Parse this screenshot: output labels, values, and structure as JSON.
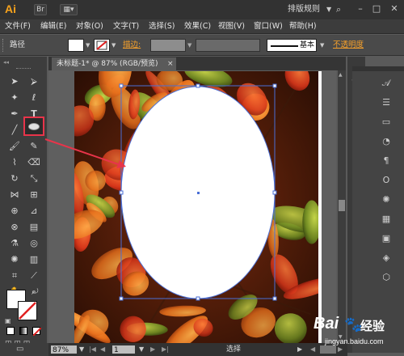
{
  "app": {
    "logo": "Ai"
  },
  "titlebar": {
    "preset_label": "排版规则",
    "buttons": [
      "Br",
      "St"
    ]
  },
  "menu": [
    "文件(F)",
    "编辑(E)",
    "对象(O)",
    "文字(T)",
    "选择(S)",
    "效果(C)",
    "视图(V)",
    "窗口(W)",
    "帮助(H)"
  ],
  "controlbar": {
    "path_label": "路径",
    "stroke_label": "描边:",
    "stroke_style": "基本",
    "opacity_label": "不透明度",
    "fill_color": "#ffffff",
    "stroke_color": "#e02020"
  },
  "document": {
    "tab_title": "未标题-1* @ 87% (RGB/预览)",
    "close": "×"
  },
  "status": {
    "zoom": "87%",
    "artboard": "1",
    "mode": "选择"
  },
  "watermark": {
    "brand": "Bai",
    "brand2": "经验",
    "url": "jingyan.baidu.com"
  },
  "colors": {
    "accent": "#f5a02b",
    "highlight": "#e8344a",
    "selection": "#4a6fd6"
  }
}
